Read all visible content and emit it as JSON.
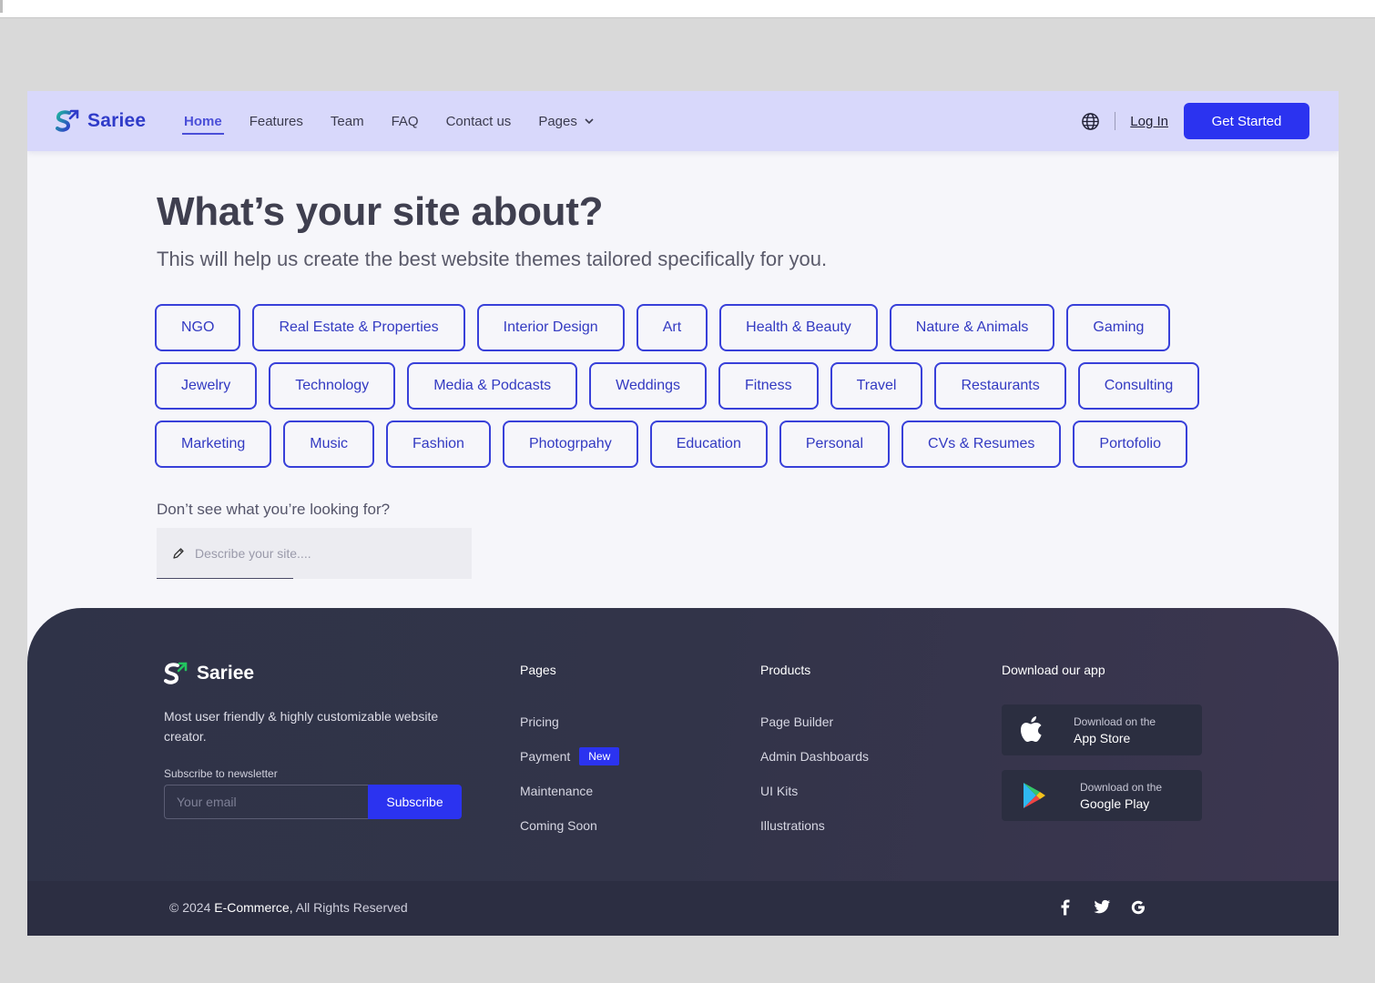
{
  "brand": {
    "name": "Sariee",
    "primary_color": "#2b33f0",
    "brand_text_color": "#2f3bc9"
  },
  "nav": {
    "links": [
      {
        "label": "Home",
        "active": true
      },
      {
        "label": "Features"
      },
      {
        "label": "Team"
      },
      {
        "label": "FAQ"
      },
      {
        "label": "Contact us"
      },
      {
        "label": "Pages",
        "has_dropdown": true
      }
    ],
    "language_icon": "globe-icon",
    "login_label": "Log In",
    "cta_label": "Get Started"
  },
  "hero": {
    "title": "What’s your site about?",
    "subtitle": "This will help us create the best website themes tailored specifically for you."
  },
  "categories": [
    "NGO",
    "Real Estate & Properties",
    "Interior Design",
    "Art",
    "Health & Beauty",
    "Nature & Animals",
    "Gaming",
    "Jewelry",
    "Technology",
    "Media & Podcasts",
    "Weddings",
    "Fitness",
    "Travel",
    "Restaurants",
    "Consulting",
    "Marketing",
    "Music",
    "Fashion",
    "Photogrpahy",
    "Education",
    "Personal",
    "CVs & Resumes",
    "Portofolio"
  ],
  "custom": {
    "prompt": "Don’t see what you’re looking for?",
    "placeholder": "Describe your site....",
    "icon": "pencil-icon"
  },
  "footer": {
    "brand_name": "Sariee",
    "tagline": "Most user friendly & highly customizable website creator.",
    "newsletter_label": "Subscribe to newsletter",
    "email_placeholder": "Your email",
    "subscribe_label": "Subscribe",
    "pages": {
      "heading": "Pages",
      "items": [
        "Pricing",
        "Payment",
        "Maintenance",
        "Coming Soon"
      ],
      "payment_badge": "New"
    },
    "products": {
      "heading": "Products",
      "items": [
        "Page Builder",
        "Admin Dashboards",
        "UI Kits",
        "Illustrations"
      ]
    },
    "app": {
      "heading": "Download our app",
      "app_store": {
        "small": "Download on the",
        "big": "App Store",
        "icon": "apple-icon"
      },
      "google_play": {
        "small": "Download on the",
        "big": "Google Play",
        "icon": "google-play-icon"
      }
    },
    "copyright_prefix": "© 2024",
    "copyright_brand": "E-Commerce,",
    "copyright_suffix": "All Rights Reserved",
    "socials": [
      "facebook-icon",
      "twitter-icon",
      "google-icon"
    ]
  }
}
